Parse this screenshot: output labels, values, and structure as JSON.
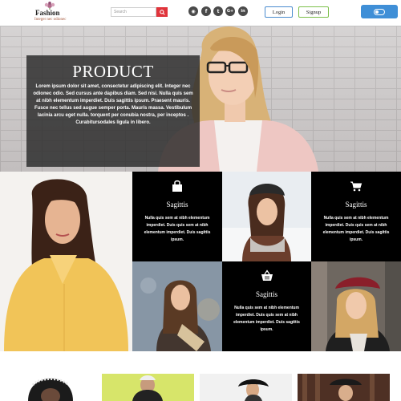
{
  "header": {
    "logo_title": "Fashion",
    "logo_subtitle": "Integer nec odionec",
    "search_placeholder": "Search",
    "social_icons": [
      "rss-icon",
      "facebook-icon",
      "twitter-icon",
      "google-plus-icon",
      "linkedin-icon"
    ],
    "social_glyphs": [
      "◉",
      "f",
      "t",
      "G+",
      "in"
    ],
    "login_label": "Login",
    "signup_label": "Signup"
  },
  "hero": {
    "title": "PRODUCT",
    "text": "Lorem ipsum dolor sit amet, consectetur adipiscing elit. Integer nec odionec odio. Sed cursus ante dapibus diam. Sed nisi. Nulla quis sem at nibh elementum imperdiet. Duis sagittis ipsum. Praesent mauris. Fusce nec tellus sed augue semper porta. Mauris massa. Vestibulum lacinia arcu eget nulla. torquent per conubia nostra, per inceptos . Curabitursodales ligula in libero."
  },
  "tiles": [
    {
      "icon": "shopping-bag-icon",
      "title": "Sagittis",
      "text": "Nulla quis sem at nibh elementum imperdiet. Duis quis sem at nibh elementum imperdiet. Duis sagittis ipsum."
    },
    {
      "icon": "shopping-cart-icon",
      "title": "Sagittis",
      "text": "Nulla quis sem at nibh elementum imperdiet. Duis quis sem at nibh elementum imperdiet. Duis sagittis ipsum."
    },
    {
      "icon": "shopping-basket-icon",
      "title": "Sagittis",
      "text": "Nulla quis sem at nibh elementum imperdiet. Duis quis sem at nibh elementum imperdiet. Duis sagittis ipsum."
    }
  ],
  "colors": {
    "accent_blue": "#3f8fd7",
    "search_red": "#e0343b",
    "login_border": "#4a8ccf",
    "signup_border": "#7cc04a",
    "dark_tile": "#000000"
  }
}
